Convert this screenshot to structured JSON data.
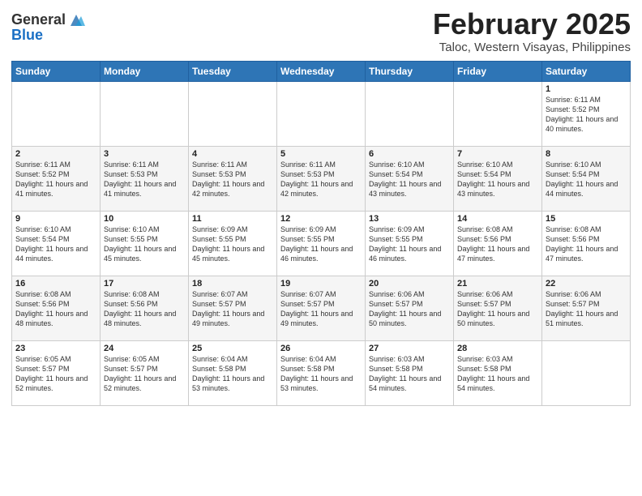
{
  "header": {
    "logo_general": "General",
    "logo_blue": "Blue",
    "month_title": "February 2025",
    "location": "Taloc, Western Visayas, Philippines"
  },
  "weekdays": [
    "Sunday",
    "Monday",
    "Tuesday",
    "Wednesday",
    "Thursday",
    "Friday",
    "Saturday"
  ],
  "weeks": [
    [
      {
        "day": "",
        "info": ""
      },
      {
        "day": "",
        "info": ""
      },
      {
        "day": "",
        "info": ""
      },
      {
        "day": "",
        "info": ""
      },
      {
        "day": "",
        "info": ""
      },
      {
        "day": "",
        "info": ""
      },
      {
        "day": "1",
        "info": "Sunrise: 6:11 AM\nSunset: 5:52 PM\nDaylight: 11 hours and 40 minutes."
      }
    ],
    [
      {
        "day": "2",
        "info": "Sunrise: 6:11 AM\nSunset: 5:52 PM\nDaylight: 11 hours and 41 minutes."
      },
      {
        "day": "3",
        "info": "Sunrise: 6:11 AM\nSunset: 5:53 PM\nDaylight: 11 hours and 41 minutes."
      },
      {
        "day": "4",
        "info": "Sunrise: 6:11 AM\nSunset: 5:53 PM\nDaylight: 11 hours and 42 minutes."
      },
      {
        "day": "5",
        "info": "Sunrise: 6:11 AM\nSunset: 5:53 PM\nDaylight: 11 hours and 42 minutes."
      },
      {
        "day": "6",
        "info": "Sunrise: 6:10 AM\nSunset: 5:54 PM\nDaylight: 11 hours and 43 minutes."
      },
      {
        "day": "7",
        "info": "Sunrise: 6:10 AM\nSunset: 5:54 PM\nDaylight: 11 hours and 43 minutes."
      },
      {
        "day": "8",
        "info": "Sunrise: 6:10 AM\nSunset: 5:54 PM\nDaylight: 11 hours and 44 minutes."
      }
    ],
    [
      {
        "day": "9",
        "info": "Sunrise: 6:10 AM\nSunset: 5:54 PM\nDaylight: 11 hours and 44 minutes."
      },
      {
        "day": "10",
        "info": "Sunrise: 6:10 AM\nSunset: 5:55 PM\nDaylight: 11 hours and 45 minutes."
      },
      {
        "day": "11",
        "info": "Sunrise: 6:09 AM\nSunset: 5:55 PM\nDaylight: 11 hours and 45 minutes."
      },
      {
        "day": "12",
        "info": "Sunrise: 6:09 AM\nSunset: 5:55 PM\nDaylight: 11 hours and 46 minutes."
      },
      {
        "day": "13",
        "info": "Sunrise: 6:09 AM\nSunset: 5:55 PM\nDaylight: 11 hours and 46 minutes."
      },
      {
        "day": "14",
        "info": "Sunrise: 6:08 AM\nSunset: 5:56 PM\nDaylight: 11 hours and 47 minutes."
      },
      {
        "day": "15",
        "info": "Sunrise: 6:08 AM\nSunset: 5:56 PM\nDaylight: 11 hours and 47 minutes."
      }
    ],
    [
      {
        "day": "16",
        "info": "Sunrise: 6:08 AM\nSunset: 5:56 PM\nDaylight: 11 hours and 48 minutes."
      },
      {
        "day": "17",
        "info": "Sunrise: 6:08 AM\nSunset: 5:56 PM\nDaylight: 11 hours and 48 minutes."
      },
      {
        "day": "18",
        "info": "Sunrise: 6:07 AM\nSunset: 5:57 PM\nDaylight: 11 hours and 49 minutes."
      },
      {
        "day": "19",
        "info": "Sunrise: 6:07 AM\nSunset: 5:57 PM\nDaylight: 11 hours and 49 minutes."
      },
      {
        "day": "20",
        "info": "Sunrise: 6:06 AM\nSunset: 5:57 PM\nDaylight: 11 hours and 50 minutes."
      },
      {
        "day": "21",
        "info": "Sunrise: 6:06 AM\nSunset: 5:57 PM\nDaylight: 11 hours and 50 minutes."
      },
      {
        "day": "22",
        "info": "Sunrise: 6:06 AM\nSunset: 5:57 PM\nDaylight: 11 hours and 51 minutes."
      }
    ],
    [
      {
        "day": "23",
        "info": "Sunrise: 6:05 AM\nSunset: 5:57 PM\nDaylight: 11 hours and 52 minutes."
      },
      {
        "day": "24",
        "info": "Sunrise: 6:05 AM\nSunset: 5:57 PM\nDaylight: 11 hours and 52 minutes."
      },
      {
        "day": "25",
        "info": "Sunrise: 6:04 AM\nSunset: 5:58 PM\nDaylight: 11 hours and 53 minutes."
      },
      {
        "day": "26",
        "info": "Sunrise: 6:04 AM\nSunset: 5:58 PM\nDaylight: 11 hours and 53 minutes."
      },
      {
        "day": "27",
        "info": "Sunrise: 6:03 AM\nSunset: 5:58 PM\nDaylight: 11 hours and 54 minutes."
      },
      {
        "day": "28",
        "info": "Sunrise: 6:03 AM\nSunset: 5:58 PM\nDaylight: 11 hours and 54 minutes."
      },
      {
        "day": "",
        "info": ""
      }
    ]
  ]
}
